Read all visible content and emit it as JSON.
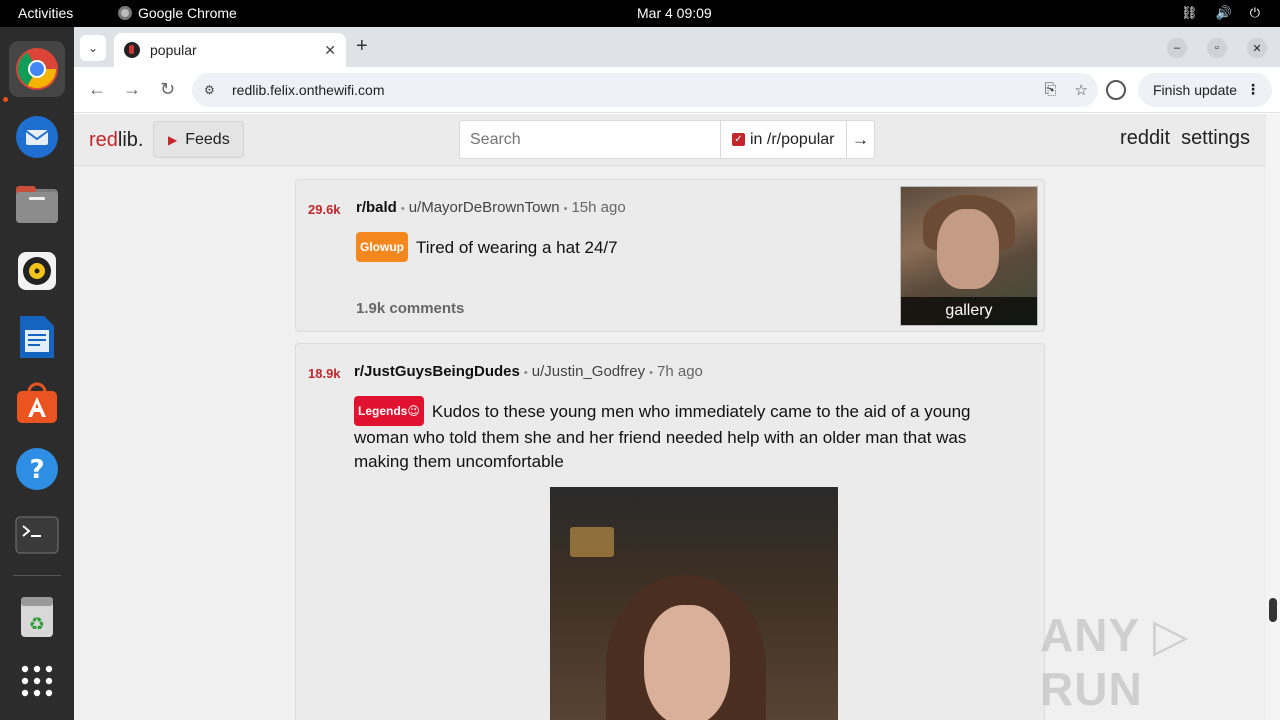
{
  "system": {
    "activities": "Activities",
    "app_name": "Google Chrome",
    "clock": "Mar 4  09:09"
  },
  "dock": {
    "apps": [
      "chrome-icon",
      "thunderbird-icon",
      "files-icon",
      "rhythmbox-icon",
      "writer-icon",
      "app-center-icon",
      "help-icon",
      "terminal-icon",
      "trash-icon",
      "app-grid-icon"
    ]
  },
  "browser": {
    "tab_title": "popular",
    "url": "redlib.felix.onthewifi.com",
    "update_label": "Finish update"
  },
  "site": {
    "logo_a": "red",
    "logo_b": "lib.",
    "feeds_label": "Feeds",
    "search_placeholder": "Search",
    "scope_label": "in /r/popular",
    "nav_reddit": "reddit",
    "nav_settings": "settings"
  },
  "posts": [
    {
      "score": "29.6k",
      "subreddit": "r/bald",
      "author": "u/MayorDeBrownTown",
      "time": "15h ago",
      "flair": "Glowup",
      "flair_color": "#f4881f",
      "title": "Tired of wearing a hat 24/7",
      "comments": "1.9k comments",
      "thumb_label": "gallery"
    },
    {
      "score": "18.9k",
      "subreddit": "r/JustGuysBeingDudes",
      "author": "u/Justin_Godfrey",
      "time": "7h ago",
      "flair": "Legends😉",
      "flair_color": "#e0122f",
      "title": "Kudos to these young men who immediately came to the aid of a young woman who told them she and her friend needed help with an older man that was making them uncomfortable"
    }
  ],
  "watermark": "ANY ▷ RUN"
}
